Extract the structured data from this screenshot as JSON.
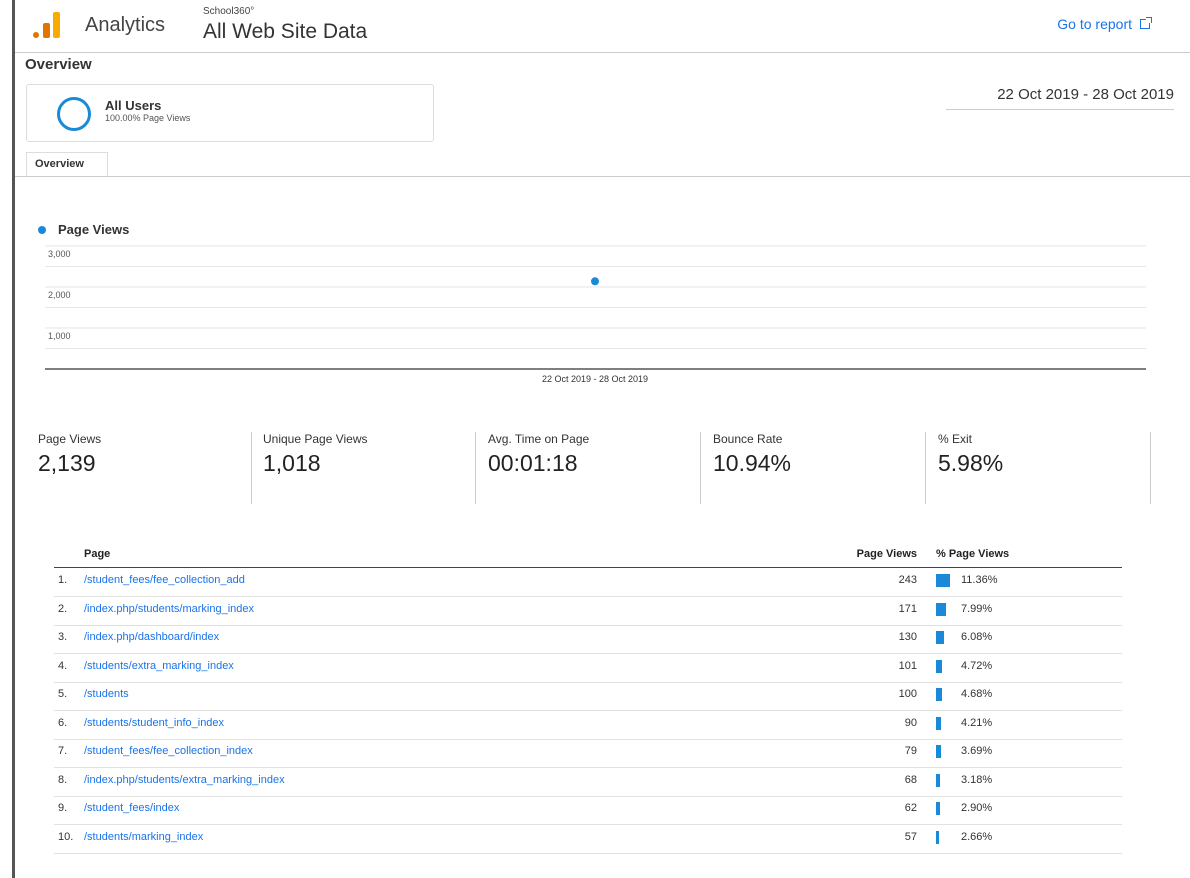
{
  "header": {
    "brand": "Analytics",
    "account": "School360°",
    "property": "All Web Site Data",
    "go_to_report": "Go to report"
  },
  "overview": {
    "title": "Overview",
    "segment": {
      "name": "All Users",
      "sub": "100.00% Page Views"
    },
    "date_range": "22 Oct 2019 - 28 Oct 2019",
    "tab": "Overview"
  },
  "chart_data": {
    "type": "scatter",
    "series": [
      {
        "name": "Page Views",
        "x": [
          "22 Oct 2019 - 28 Oct 2019"
        ],
        "values": [
          2139
        ]
      }
    ],
    "ytick_labels": [
      "3,000",
      "2,000",
      "1,000"
    ],
    "xtick_labels": [
      "22 Oct 2019 - 28 Oct 2019"
    ],
    "ylim": [
      0,
      3000
    ],
    "grid": true,
    "legend": "top-left",
    "color": "#1a8ad8"
  },
  "metrics": [
    {
      "label": "Page Views",
      "value": "2,139"
    },
    {
      "label": "Unique Page Views",
      "value": "1,018"
    },
    {
      "label": "Avg. Time on Page",
      "value": "00:01:18"
    },
    {
      "label": "Bounce Rate",
      "value": "10.94%"
    },
    {
      "label": "% Exit",
      "value": "5.98%"
    }
  ],
  "table": {
    "headers": {
      "page": "Page",
      "page_views": "Page Views",
      "pct_page_views": "% Page Views"
    },
    "rows": [
      {
        "num": "1.",
        "page": "/student_fees/fee_collection_add",
        "views": "243",
        "pct": "11.36%",
        "pct_value": 11.36
      },
      {
        "num": "2.",
        "page": "/index.php/students/marking_index",
        "views": "171",
        "pct": "7.99%",
        "pct_value": 7.99
      },
      {
        "num": "3.",
        "page": "/index.php/dashboard/index",
        "views": "130",
        "pct": "6.08%",
        "pct_value": 6.08
      },
      {
        "num": "4.",
        "page": "/students/extra_marking_index",
        "views": "101",
        "pct": "4.72%",
        "pct_value": 4.72
      },
      {
        "num": "5.",
        "page": "/students",
        "views": "100",
        "pct": "4.68%",
        "pct_value": 4.68
      },
      {
        "num": "6.",
        "page": "/students/student_info_index",
        "views": "90",
        "pct": "4.21%",
        "pct_value": 4.21
      },
      {
        "num": "7.",
        "page": "/student_fees/fee_collection_index",
        "views": "79",
        "pct": "3.69%",
        "pct_value": 3.69
      },
      {
        "num": "8.",
        "page": "/index.php/students/extra_marking_index",
        "views": "68",
        "pct": "3.18%",
        "pct_value": 3.18
      },
      {
        "num": "9.",
        "page": "/student_fees/index",
        "views": "62",
        "pct": "2.90%",
        "pct_value": 2.9
      },
      {
        "num": "10.",
        "page": "/students/marking_index",
        "views": "57",
        "pct": "2.66%",
        "pct_value": 2.66
      }
    ]
  },
  "colors": {
    "accent": "#1a8ad8",
    "link": "#1a73e8",
    "logo_orange": "#f9ab00",
    "logo_dark_orange": "#e37400"
  }
}
